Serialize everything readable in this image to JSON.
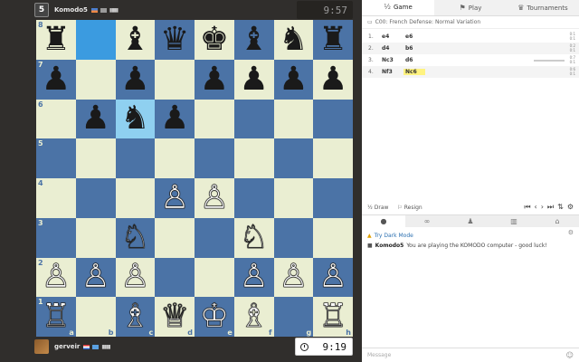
{
  "top_player": {
    "name": "Komodo5",
    "avatar": "5",
    "clock": "9:57",
    "rating_icon": "signal-bars-icon"
  },
  "bottom_player": {
    "name": "gerveir",
    "clock": "9:19",
    "rating_icon": "signal-bars-icon"
  },
  "board": {
    "ranks": [
      "8",
      "7",
      "6",
      "5",
      "4",
      "3",
      "2",
      "1"
    ],
    "files": [
      "a",
      "b",
      "c",
      "d",
      "e",
      "f",
      "g",
      "h"
    ],
    "rows": [
      [
        {
          "p": "♜",
          "c": "b"
        },
        {
          "p": "",
          "c": ""
        },
        {
          "p": "♝",
          "c": "b"
        },
        {
          "p": "♛",
          "c": "b"
        },
        {
          "p": "♚",
          "c": "b"
        },
        {
          "p": "♝",
          "c": "b"
        },
        {
          "p": "♞",
          "c": "b"
        },
        {
          "p": "♜",
          "c": "b"
        }
      ],
      [
        {
          "p": "♟",
          "c": "b"
        },
        {
          "p": "",
          "c": ""
        },
        {
          "p": "♟",
          "c": "b"
        },
        {
          "p": "",
          "c": ""
        },
        {
          "p": "♟",
          "c": "b"
        },
        {
          "p": "♟",
          "c": "b"
        },
        {
          "p": "♟",
          "c": "b"
        },
        {
          "p": "♟",
          "c": "b"
        }
      ],
      [
        {
          "p": "",
          "c": ""
        },
        {
          "p": "♟",
          "c": "b"
        },
        {
          "p": "♞",
          "c": "b"
        },
        {
          "p": "♟",
          "c": "b"
        },
        {
          "p": "",
          "c": ""
        },
        {
          "p": "",
          "c": ""
        },
        {
          "p": "",
          "c": ""
        },
        {
          "p": "",
          "c": ""
        }
      ],
      [
        {
          "p": "",
          "c": ""
        },
        {
          "p": "",
          "c": ""
        },
        {
          "p": "",
          "c": ""
        },
        {
          "p": "",
          "c": ""
        },
        {
          "p": "",
          "c": ""
        },
        {
          "p": "",
          "c": ""
        },
        {
          "p": "",
          "c": ""
        },
        {
          "p": "",
          "c": ""
        }
      ],
      [
        {
          "p": "",
          "c": ""
        },
        {
          "p": "",
          "c": ""
        },
        {
          "p": "",
          "c": ""
        },
        {
          "p": "♙",
          "c": "w"
        },
        {
          "p": "♙",
          "c": "w"
        },
        {
          "p": "",
          "c": ""
        },
        {
          "p": "",
          "c": ""
        },
        {
          "p": "",
          "c": ""
        }
      ],
      [
        {
          "p": "",
          "c": ""
        },
        {
          "p": "",
          "c": ""
        },
        {
          "p": "♘",
          "c": "w"
        },
        {
          "p": "",
          "c": ""
        },
        {
          "p": "",
          "c": ""
        },
        {
          "p": "♘",
          "c": "w"
        },
        {
          "p": "",
          "c": ""
        },
        {
          "p": "",
          "c": ""
        }
      ],
      [
        {
          "p": "♙",
          "c": "w"
        },
        {
          "p": "♙",
          "c": "w"
        },
        {
          "p": "♙",
          "c": "w"
        },
        {
          "p": "",
          "c": ""
        },
        {
          "p": "",
          "c": ""
        },
        {
          "p": "♙",
          "c": "w"
        },
        {
          "p": "♙",
          "c": "w"
        },
        {
          "p": "♙",
          "c": "w"
        }
      ],
      [
        {
          "p": "♖",
          "c": "w"
        },
        {
          "p": "",
          "c": ""
        },
        {
          "p": "♗",
          "c": "w"
        },
        {
          "p": "♕",
          "c": "w"
        },
        {
          "p": "♔",
          "c": "w"
        },
        {
          "p": "♗",
          "c": "w"
        },
        {
          "p": "",
          "c": ""
        },
        {
          "p": "♖",
          "c": "w"
        }
      ]
    ],
    "highlighted": [
      "b8",
      "c6"
    ]
  },
  "tabs": [
    {
      "label": "Game",
      "icon": "½"
    },
    {
      "label": "Play",
      "icon": "⚑"
    },
    {
      "label": "Tournaments",
      "icon": "♛"
    }
  ],
  "opening": "C00: French Defense: Normal Variation",
  "moves": [
    {
      "num": "1.",
      "white": "e4",
      "black": "e6",
      "t1": "0:1",
      "t2": "0:1"
    },
    {
      "num": "2.",
      "white": "d4",
      "black": "b6",
      "t1": "0:2",
      "t2": "0:1"
    },
    {
      "num": "3.",
      "white": "Nc3",
      "black": "d6",
      "t1": "0:7",
      "t2": "0:1"
    },
    {
      "num": "4.",
      "white": "Nf3",
      "black": "Nc6",
      "t1": "0:6",
      "t2": "0:1"
    }
  ],
  "controls": {
    "draw": "Draw",
    "resign": "Resign",
    "draw_icon": "½"
  },
  "chat": {
    "dark_mode": "Try Dark Mode",
    "user": "Komodo5",
    "message": "You are playing the KOMODO computer - good luck!",
    "placeholder": "Message"
  }
}
